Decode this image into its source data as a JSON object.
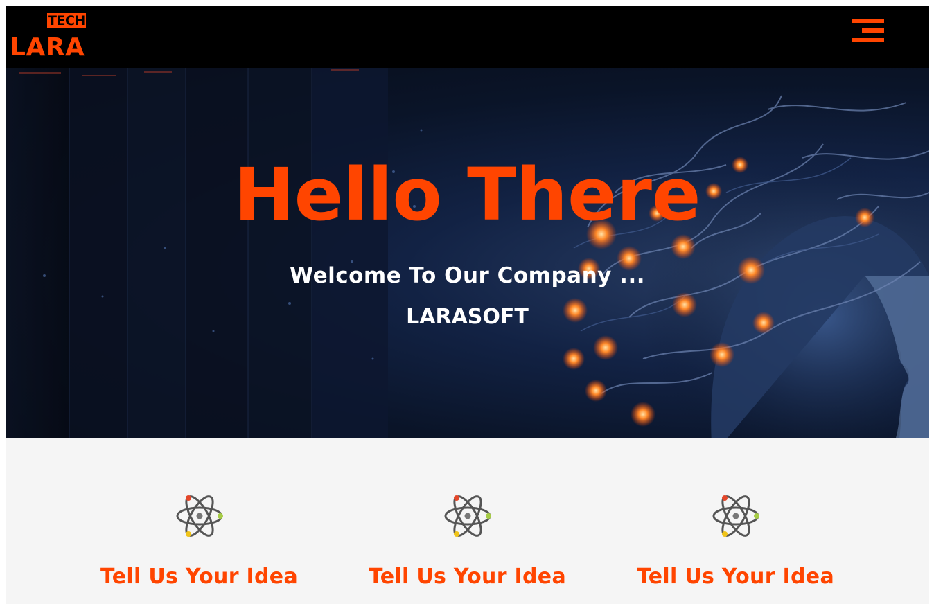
{
  "navbar": {
    "logo_top": "TECH",
    "logo_main": "LARA",
    "menu_icon": "hamburger-menu-icon"
  },
  "hero": {
    "title": "Hello There",
    "welcome": "Welcome To Our Company ...",
    "brand": "LARASOFT",
    "background": "ai-brain-neural-network-image"
  },
  "features": [
    {
      "icon": "atom-icon",
      "title": "Tell Us Your Idea"
    },
    {
      "icon": "atom-icon",
      "title": "Tell Us Your Idea"
    },
    {
      "icon": "atom-icon",
      "title": "Tell Us Your Idea"
    }
  ],
  "colors": {
    "accent": "#ff4500",
    "navbar_bg": "#000000",
    "section_bg": "#f5f5f5",
    "hero_text": "#ffffff"
  }
}
